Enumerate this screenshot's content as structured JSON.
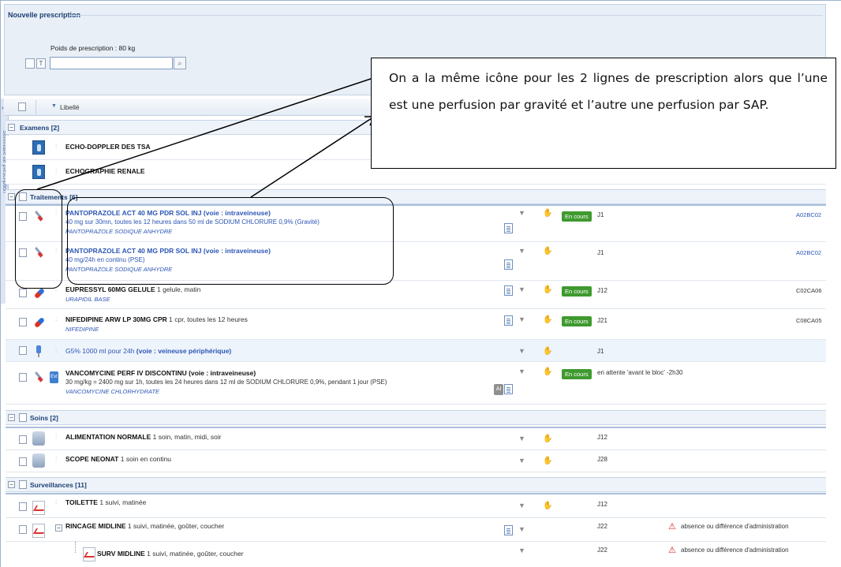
{
  "panel": {
    "title": "Nouvelle prescription",
    "weight_label": "Poids de prescription : 80 kg",
    "search_value": ""
  },
  "grid": {
    "column_label": "Libellé",
    "side_tab_label": "Sommaire de prescription"
  },
  "groups": {
    "examens": "Examens [2]",
    "traitements": "Traitements [6]",
    "soins": "Soins [2]",
    "surveillances": "Surveillances [11]"
  },
  "exams": [
    {
      "label": "ECHO-DOPPLER DES TSA"
    },
    {
      "label": "ECHOGRAPHIE RENALE"
    }
  ],
  "treatments": [
    {
      "title": "PANTOPRAZOLE ACT 40 MG PDR SOL INJ (voie : intraveineuse)",
      "detail": "40 mg sur 30mn, toutes les 12 heures dans 50 ml de SODIUM CHLORURE 0,9% (Gravité)",
      "molecule": "PANTOPRAZOLE SODIQUE ANHYDRE",
      "status": "En cours",
      "day": "J1",
      "code": "A02BC02",
      "icon": "syringe-icon"
    },
    {
      "title": "PANTOPRAZOLE ACT 40 MG PDR SOL INJ (voie : intraveineuse)",
      "detail": "40 mg/24h en continu (PSE)",
      "molecule": "PANTOPRAZOLE SODIQUE ANHYDRE",
      "status": "",
      "day": "J1",
      "code": "A02BC02",
      "icon": "syringe-icon"
    },
    {
      "title": "EUPRESSYL 60MG GELULE",
      "title_extra": "1 gelule, matin",
      "molecule": "URAPIDIL BASE",
      "status": "En cours",
      "day": "J12",
      "code": "C02CA06",
      "icon": "pill-icon"
    },
    {
      "title": "NIFEDIPINE ARW LP 30MG CPR",
      "title_extra": "1 cpr, toutes les 12 heures",
      "molecule": "NIFEDIPINE",
      "status": "En cours",
      "day": "J21",
      "code": "C08CA05",
      "icon": "pill-icon"
    },
    {
      "title": "G5% 1000 ml pour 24h",
      "title_extra": "(voie : veineuse périphérique)",
      "day": "J1",
      "icon": "drip-icon"
    },
    {
      "title": "VANCOMYCINE PERF IV DISCONTINU (voie : intraveineuse)",
      "detail": "30 mg/kg = 2400 mg sur 1h, toutes les 24 heures dans 12 ml de SODIUM CHLORURE 0,9%, pendant 1 jour (PSE)",
      "molecule": "VANCOMYCINE CHLORHYDRATE",
      "status": "En cours",
      "day": "en attente 'avant le bloc' -2h30",
      "evt": "Evt",
      "ai": "AI",
      "icon": "syringe-icon"
    }
  ],
  "care": [
    {
      "title": "ALIMENTATION NORMALE",
      "title_extra": "1 soin, matin, midi, soir",
      "day": "J12"
    },
    {
      "title": "SCOPE NEONAT",
      "title_extra": "1 soin en continu",
      "day": "J28"
    }
  ],
  "surveillance": [
    {
      "title": "TOILETTE",
      "title_extra": "1 suivi, matinée",
      "day": "J12"
    },
    {
      "title": "RINCAGE MIDLINE",
      "title_extra": "1 suivi, matinée, goûter, coucher",
      "day": "J22",
      "warning": "absence ou différence d'administration"
    },
    {
      "title": "SURV MIDLINE",
      "title_extra": "1 suivi, matinée, goûter, coucher",
      "day": "J22",
      "warning": "absence ou différence d'administration"
    }
  ],
  "annotation": {
    "text": "On a la même icône pour les 2 lignes de prescription alors que l’une est une perfusion par gravité et l’autre une perfusion par SAP."
  },
  "colors": {
    "status_green": "#3f9a2f",
    "link_blue": "#2c56b5",
    "header_blue": "#1d3f73",
    "warning_red": "#d82020"
  }
}
